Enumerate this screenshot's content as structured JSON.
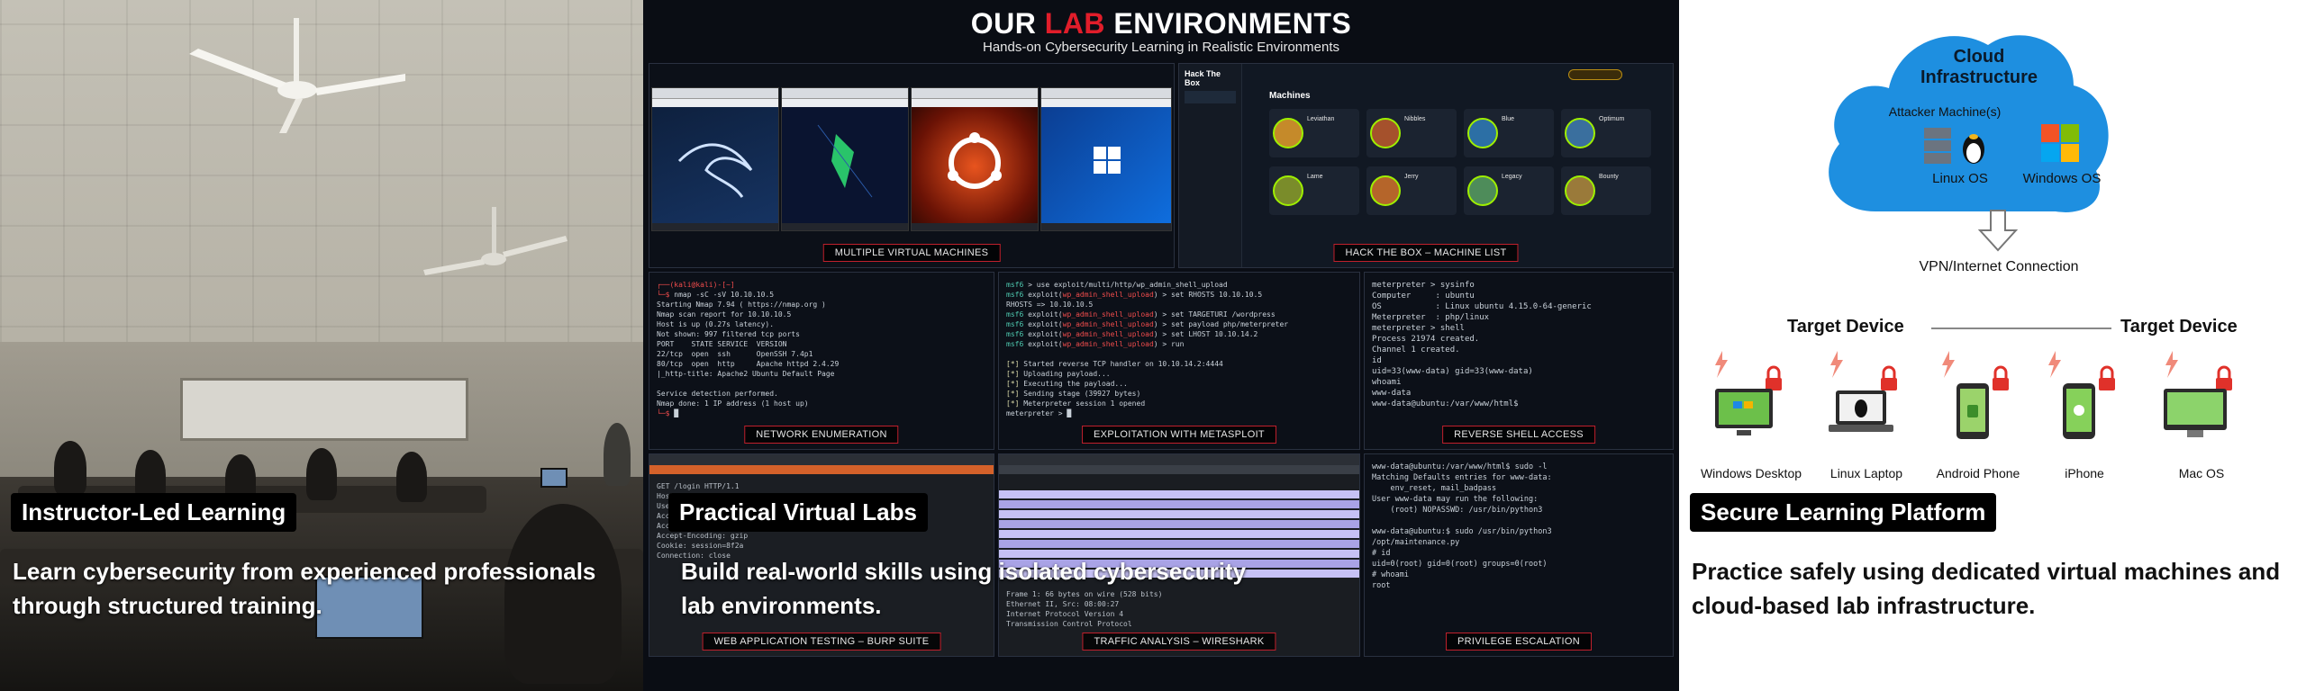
{
  "panel_instructor": {
    "badge": "Instructor-Led Learning",
    "caption": "Learn cybersecurity from experienced professionals through structured training."
  },
  "panel_labs": {
    "title_before": "OUR ",
    "title_accent": "LAB",
    "title_after": " ENVIRONMENTS",
    "subtitle": "Hands-on Cybersecurity Learning in Realistic Environments",
    "tiles": {
      "vms": "MULTIPLE VIRTUAL MACHINES",
      "htb": "HACK THE BOX – MACHINE LIST",
      "nmap": "NETWORK ENUMERATION",
      "msf": "EXPLOITATION WITH METASPLOIT",
      "shell": "REVERSE SHELL ACCESS",
      "burp": "WEB APPLICATION TESTING – BURP SUITE",
      "wireshark": "TRAFFIC ANALYSIS – WIRESHARK",
      "privesc": "PRIVILEGE ESCALATION"
    },
    "htb_brand": "Hack The Box",
    "htb_section": "Machines",
    "htb_machines": [
      "Leviathan",
      "Nibbles",
      "Blue",
      "Optimum",
      "Lame",
      "Jerry",
      "Legacy",
      "Bounty"
    ],
    "badge": "Practical Virtual Labs",
    "caption": "Build real-world skills using isolated cybersecurity lab environments."
  },
  "panel_platform": {
    "cloud_title": "Cloud Infrastructure",
    "attacker": "Attacker Machine(s)",
    "linux": "Linux OS",
    "windows": "Windows OS",
    "connection": "VPN/Internet Connection",
    "target_left": "Target Device",
    "target_right": "Target Device",
    "devices": [
      "Windows Desktop",
      "Linux Laptop",
      "Android Phone",
      "iPhone",
      "Mac OS"
    ],
    "badge": "Secure Learning Platform",
    "caption": "Practice safely using dedicated virtual machines and cloud-based lab infrastructure."
  },
  "colors": {
    "accent_red": "#e11d2a",
    "cloud_blue": "#1e8fe0",
    "lock_red": "#e0312a"
  }
}
